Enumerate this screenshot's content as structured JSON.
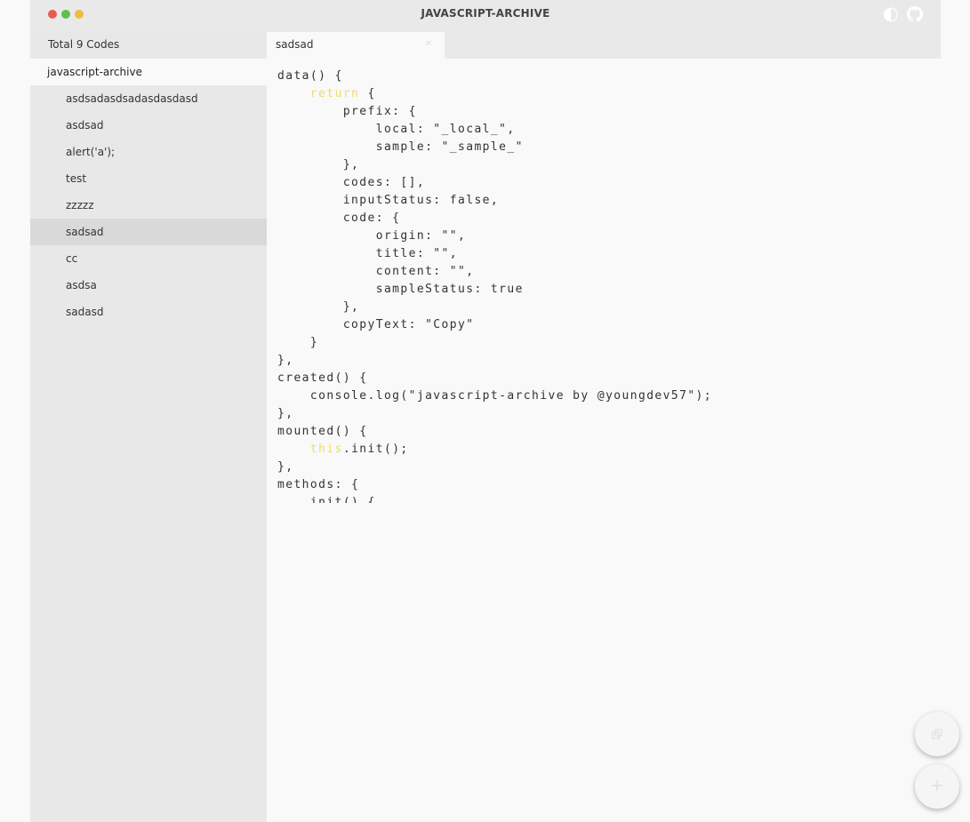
{
  "window": {
    "title": "JAVASCRIPT-ARCHIVE"
  },
  "titlebar": {
    "traffic_lights": [
      "#e75c4f",
      "#5cbf4e",
      "#eebb3f"
    ],
    "icons": [
      "theme-toggle-icon",
      "github-icon"
    ]
  },
  "sidebar": {
    "total_label": "Total 9 Codes",
    "folder": "javascript-archive",
    "items": [
      {
        "label": "asdsadasdsadasdasdasd"
      },
      {
        "label": "asdsad"
      },
      {
        "label": "alert('a');"
      },
      {
        "label": "test"
      },
      {
        "label": "zzzzz"
      },
      {
        "label": "sadsad",
        "active": true
      },
      {
        "label": "cc"
      },
      {
        "label": "asdsa"
      },
      {
        "label": "sadasd"
      }
    ]
  },
  "tab": {
    "label": "sadsad",
    "close_icon": "close-icon"
  },
  "editor": {
    "keyword_color": "#ecdd70",
    "lines": [
      "data() {",
      "    return {",
      "        prefix: {",
      "            local: \"_local_\",",
      "            sample: \"_sample_\"",
      "        },",
      "        codes: [],",
      "        inputStatus: false,",
      "        code: {",
      "            origin: \"\",",
      "            title: \"\",",
      "            content: \"\",",
      "            sampleStatus: true",
      "        },",
      "        copyText: \"Copy\"",
      "    }",
      "},",
      "created() {",
      "    console.log(\"javascript-archive by @youngdev57\");",
      "},",
      "mounted() {",
      "    this.init();",
      "},",
      "methods: {",
      "    init() {"
    ]
  },
  "fabs": [
    {
      "icon": "copy-icon"
    },
    {
      "icon": "add-icon"
    }
  ]
}
